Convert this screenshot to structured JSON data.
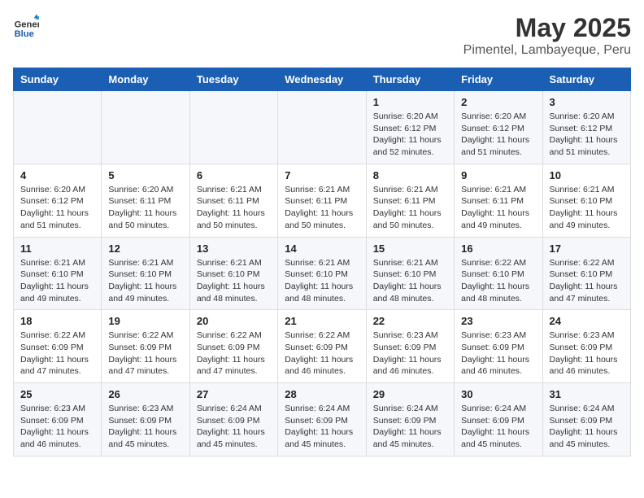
{
  "header": {
    "logo_general": "General",
    "logo_blue": "Blue",
    "title": "May 2025",
    "subtitle": "Pimentel, Lambayeque, Peru"
  },
  "days_of_week": [
    "Sunday",
    "Monday",
    "Tuesday",
    "Wednesday",
    "Thursday",
    "Friday",
    "Saturday"
  ],
  "weeks": [
    [
      {
        "day": "",
        "info": ""
      },
      {
        "day": "",
        "info": ""
      },
      {
        "day": "",
        "info": ""
      },
      {
        "day": "",
        "info": ""
      },
      {
        "day": "1",
        "info": "Sunrise: 6:20 AM\nSunset: 6:12 PM\nDaylight: 11 hours and 52 minutes."
      },
      {
        "day": "2",
        "info": "Sunrise: 6:20 AM\nSunset: 6:12 PM\nDaylight: 11 hours and 51 minutes."
      },
      {
        "day": "3",
        "info": "Sunrise: 6:20 AM\nSunset: 6:12 PM\nDaylight: 11 hours and 51 minutes."
      }
    ],
    [
      {
        "day": "4",
        "info": "Sunrise: 6:20 AM\nSunset: 6:12 PM\nDaylight: 11 hours and 51 minutes."
      },
      {
        "day": "5",
        "info": "Sunrise: 6:20 AM\nSunset: 6:11 PM\nDaylight: 11 hours and 50 minutes."
      },
      {
        "day": "6",
        "info": "Sunrise: 6:21 AM\nSunset: 6:11 PM\nDaylight: 11 hours and 50 minutes."
      },
      {
        "day": "7",
        "info": "Sunrise: 6:21 AM\nSunset: 6:11 PM\nDaylight: 11 hours and 50 minutes."
      },
      {
        "day": "8",
        "info": "Sunrise: 6:21 AM\nSunset: 6:11 PM\nDaylight: 11 hours and 50 minutes."
      },
      {
        "day": "9",
        "info": "Sunrise: 6:21 AM\nSunset: 6:11 PM\nDaylight: 11 hours and 49 minutes."
      },
      {
        "day": "10",
        "info": "Sunrise: 6:21 AM\nSunset: 6:10 PM\nDaylight: 11 hours and 49 minutes."
      }
    ],
    [
      {
        "day": "11",
        "info": "Sunrise: 6:21 AM\nSunset: 6:10 PM\nDaylight: 11 hours and 49 minutes."
      },
      {
        "day": "12",
        "info": "Sunrise: 6:21 AM\nSunset: 6:10 PM\nDaylight: 11 hours and 49 minutes."
      },
      {
        "day": "13",
        "info": "Sunrise: 6:21 AM\nSunset: 6:10 PM\nDaylight: 11 hours and 48 minutes."
      },
      {
        "day": "14",
        "info": "Sunrise: 6:21 AM\nSunset: 6:10 PM\nDaylight: 11 hours and 48 minutes."
      },
      {
        "day": "15",
        "info": "Sunrise: 6:21 AM\nSunset: 6:10 PM\nDaylight: 11 hours and 48 minutes."
      },
      {
        "day": "16",
        "info": "Sunrise: 6:22 AM\nSunset: 6:10 PM\nDaylight: 11 hours and 48 minutes."
      },
      {
        "day": "17",
        "info": "Sunrise: 6:22 AM\nSunset: 6:10 PM\nDaylight: 11 hours and 47 minutes."
      }
    ],
    [
      {
        "day": "18",
        "info": "Sunrise: 6:22 AM\nSunset: 6:09 PM\nDaylight: 11 hours and 47 minutes."
      },
      {
        "day": "19",
        "info": "Sunrise: 6:22 AM\nSunset: 6:09 PM\nDaylight: 11 hours and 47 minutes."
      },
      {
        "day": "20",
        "info": "Sunrise: 6:22 AM\nSunset: 6:09 PM\nDaylight: 11 hours and 47 minutes."
      },
      {
        "day": "21",
        "info": "Sunrise: 6:22 AM\nSunset: 6:09 PM\nDaylight: 11 hours and 46 minutes."
      },
      {
        "day": "22",
        "info": "Sunrise: 6:23 AM\nSunset: 6:09 PM\nDaylight: 11 hours and 46 minutes."
      },
      {
        "day": "23",
        "info": "Sunrise: 6:23 AM\nSunset: 6:09 PM\nDaylight: 11 hours and 46 minutes."
      },
      {
        "day": "24",
        "info": "Sunrise: 6:23 AM\nSunset: 6:09 PM\nDaylight: 11 hours and 46 minutes."
      }
    ],
    [
      {
        "day": "25",
        "info": "Sunrise: 6:23 AM\nSunset: 6:09 PM\nDaylight: 11 hours and 46 minutes."
      },
      {
        "day": "26",
        "info": "Sunrise: 6:23 AM\nSunset: 6:09 PM\nDaylight: 11 hours and 45 minutes."
      },
      {
        "day": "27",
        "info": "Sunrise: 6:24 AM\nSunset: 6:09 PM\nDaylight: 11 hours and 45 minutes."
      },
      {
        "day": "28",
        "info": "Sunrise: 6:24 AM\nSunset: 6:09 PM\nDaylight: 11 hours and 45 minutes."
      },
      {
        "day": "29",
        "info": "Sunrise: 6:24 AM\nSunset: 6:09 PM\nDaylight: 11 hours and 45 minutes."
      },
      {
        "day": "30",
        "info": "Sunrise: 6:24 AM\nSunset: 6:09 PM\nDaylight: 11 hours and 45 minutes."
      },
      {
        "day": "31",
        "info": "Sunrise: 6:24 AM\nSunset: 6:09 PM\nDaylight: 11 hours and 45 minutes."
      }
    ]
  ]
}
